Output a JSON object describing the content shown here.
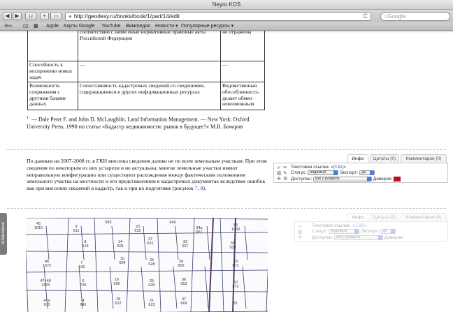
{
  "browser": {
    "window_title": "Neyro KOS",
    "url": "http://geodesy.ru/books/book/1/part/14/edit",
    "search_placeholder": "Google",
    "bookmarks": [
      "Apple",
      "Карты Google",
      "YouTube",
      "Википедия",
      "Новости ▾",
      "Популярные ресурсы ▾"
    ]
  },
  "table": {
    "rows": [
      [
        "",
        "законы, другие федеральные законы и издаваемые в соответствии с ними иные нормативные правовые акты Российской Федерации",
        "Многие моменты не отражены"
      ],
      [
        "Способность к восприятию новых задач",
        "—",
        "—"
      ],
      [
        "Возможность сопряжения с другими базами данных",
        "Сопоставимость кадастровых сведений со сведениями, содержащимися в других информационных ресурсах",
        "Ведомственная обособленность делает обмен невозможным"
      ]
    ]
  },
  "footnote": {
    "number": "1",
    "text": "— Dale Peter F. and John D. McLaughlin. Land Information Management. — New York: Oxford University Press, 1990 по статье «Кадастр недвижимости: рывок в будущее?» М.В. Бочаров"
  },
  "paragraph": {
    "text": "По данным на 2007-2008 гг. в ГКН внесены сведения далеко не по всем земельным участкам. При этом сведения по некоторым из них устарели и не актуальны, многие земельные участки имеют неправильную конфигурацию или существуют расхождения между фактическим положением земельного участка на местности и его представлением в кадастровых документах вследствие ошибок как при внесении сведений в кадастр, так и при их подготовке (рисунок ",
    "ref1": "7",
    "sep": ", ",
    "ref2": "8",
    "end": ")."
  },
  "info_panel": {
    "tabs": [
      "Инфо",
      "Цитаты (0)",
      "Комментарии (0)"
    ],
    "link_label": "Текстовая ссылка:",
    "link_value": "«[131]»",
    "status_label": "Статус:",
    "status_value": "видимый",
    "export_label": "Экспорт:",
    "export_value": "да",
    "access_label": "Доступен:",
    "access_value": "как у раздела",
    "trust_label": "Доверие:",
    "trust_color": "#b2151b"
  },
  "info_panel_ghost": {
    "tabs": [
      "Инфо",
      "Цитаты (0)",
      "Комментарии (0)"
    ],
    "link_label": "Текстовая ссылка:",
    "link_value": "«[132]»",
    "status_label": "Статус:",
    "status_value": "видимый",
    "export_label": "Экспорт:",
    "export_value": "да",
    "access_label": "Доступен:",
    "access_value": "как у раздела",
    "trust_label": "Доверие:"
  },
  "map": {
    "parcels": [
      [
        "45",
        "1610"
      ],
      [
        "9",
        "611"
      ],
      [
        "582",
        ""
      ],
      [
        "23",
        "632"
      ],
      [
        "649",
        ""
      ],
      [
        "34a",
        "651"
      ],
      [
        "56",
        "1009"
      ],
      [
        "8",
        "619"
      ],
      [
        "14",
        "605"
      ],
      [
        "27",
        "631"
      ],
      [
        "33",
        "657"
      ],
      [
        "55",
        "936"
      ],
      [
        "46",
        "1672"
      ],
      [
        "7",
        "642"
      ],
      [
        "15",
        "604"
      ],
      [
        "26",
        "628"
      ],
      [
        "34",
        "655"
      ],
      [
        "53",
        "671"
      ],
      [
        "47+48",
        "1378"
      ],
      [
        "6",
        "736"
      ],
      [
        "16",
        "595"
      ],
      [
        "25",
        "630"
      ],
      [
        "36",
        "653"
      ],
      [
        "52",
        "672"
      ],
      [
        "47a",
        "975"
      ],
      [
        "4",
        "641"
      ],
      [
        "18",
        "622"
      ],
      [
        "21",
        "623"
      ],
      [
        "37",
        "669"
      ],
      [
        "51",
        ""
      ]
    ]
  },
  "side_tab": "оглавление"
}
